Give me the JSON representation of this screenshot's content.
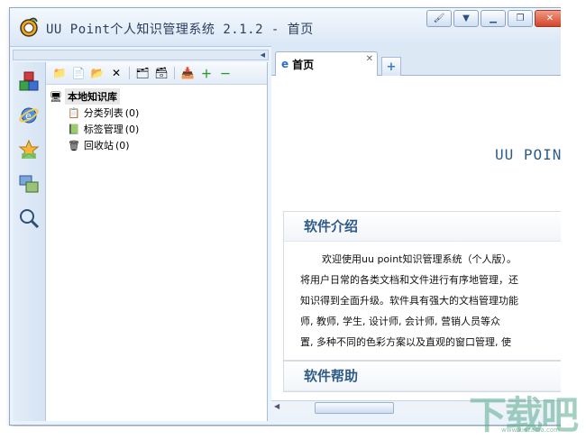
{
  "window": {
    "title": "UU Point个人知识管理系统 2.1.2 - 首页"
  },
  "sidebar": {
    "items": [
      {
        "icon": "cubes-icon"
      },
      {
        "icon": "ie-globe-icon"
      },
      {
        "icon": "star-icon"
      },
      {
        "icon": "windows-icon"
      },
      {
        "icon": "magnifier-icon"
      }
    ]
  },
  "tree": {
    "root_label": "本地知识库",
    "items": [
      {
        "label": "分类列表",
        "count": "(0)",
        "icon": "category-icon"
      },
      {
        "label": "标签管理",
        "count": "(0)",
        "icon": "tag-icon"
      },
      {
        "label": "回收站",
        "count": "(0)",
        "icon": "trash-icon"
      }
    ]
  },
  "tabs": {
    "active": "首页",
    "new_tab_symbol": "+"
  },
  "content": {
    "hero_text": "UU POIN",
    "intro_title": "软件介绍",
    "intro_lines": [
      "欢迎使用uu point知识管理系统（个人版）。",
      "将用户日常的各类文档和文件进行有序地管理，还",
      "知识得到全面升级。软件具有强大的文档管理功能",
      "师, 教师, 学生, 设计师, 会计师, 营销人员等众",
      "置, 多种不同的色彩方案以及直观的窗口管理, 使"
    ],
    "help_title": "软件帮助"
  },
  "watermark": {
    "text": "下载吧",
    "url": "www.xiazaiba.com"
  },
  "colors": {
    "accent": "#2e5b86",
    "close": "#d2452a"
  }
}
